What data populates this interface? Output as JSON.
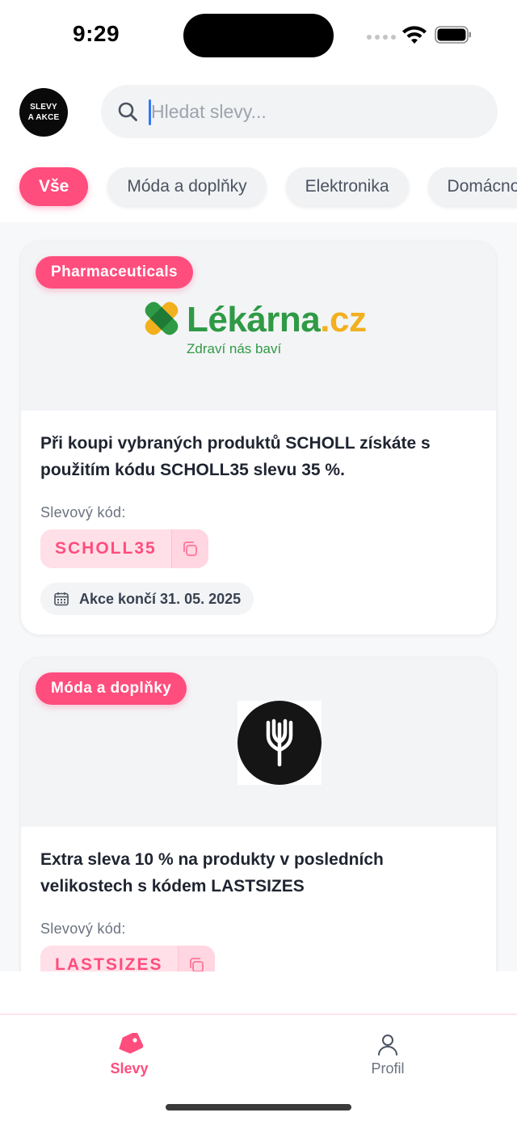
{
  "status_bar": {
    "time": "9:29"
  },
  "header": {
    "logo_line1": "SLEVY",
    "logo_line2": "A AKCE",
    "search_placeholder": "Hledat slevy..."
  },
  "categories": [
    {
      "label": "Vše",
      "active": true
    },
    {
      "label": "Móda a doplňky",
      "active": false
    },
    {
      "label": "Elektronika",
      "active": false
    },
    {
      "label": "Domácnost",
      "active": false
    }
  ],
  "deals": [
    {
      "category": "Pharmaceuticals",
      "brand_logo": {
        "word": "Lékárna",
        "suffix": ".cz",
        "tagline": "Zdraví nás baví"
      },
      "title": "Při koupi vybraných produktů SCHOLL získáte s použitím kódu SCHOLL35 slevu 35 %.",
      "code_label": "Slevový kód:",
      "code": "SCHOLL35",
      "expiry": "Akce končí 31. 05. 2025"
    },
    {
      "category": "Móda a doplňky",
      "brand_logo_icon": "wheat-emblem-icon",
      "title": "Extra sleva 10 % na produkty v posledních velikostech s kódem LASTSIZES",
      "code_label": "Slevový kód:",
      "code": "LASTSIZES"
    }
  ],
  "bottom_nav": [
    {
      "label": "Slevy",
      "icon": "tag-icon",
      "active": true
    },
    {
      "label": "Profil",
      "icon": "user-icon",
      "active": false
    }
  ],
  "colors": {
    "accent": "#ff4d7d",
    "code_bg": "#ffe0e8",
    "lekarna_green": "#2f9a45",
    "lekarna_yellow": "#f2b01e"
  }
}
